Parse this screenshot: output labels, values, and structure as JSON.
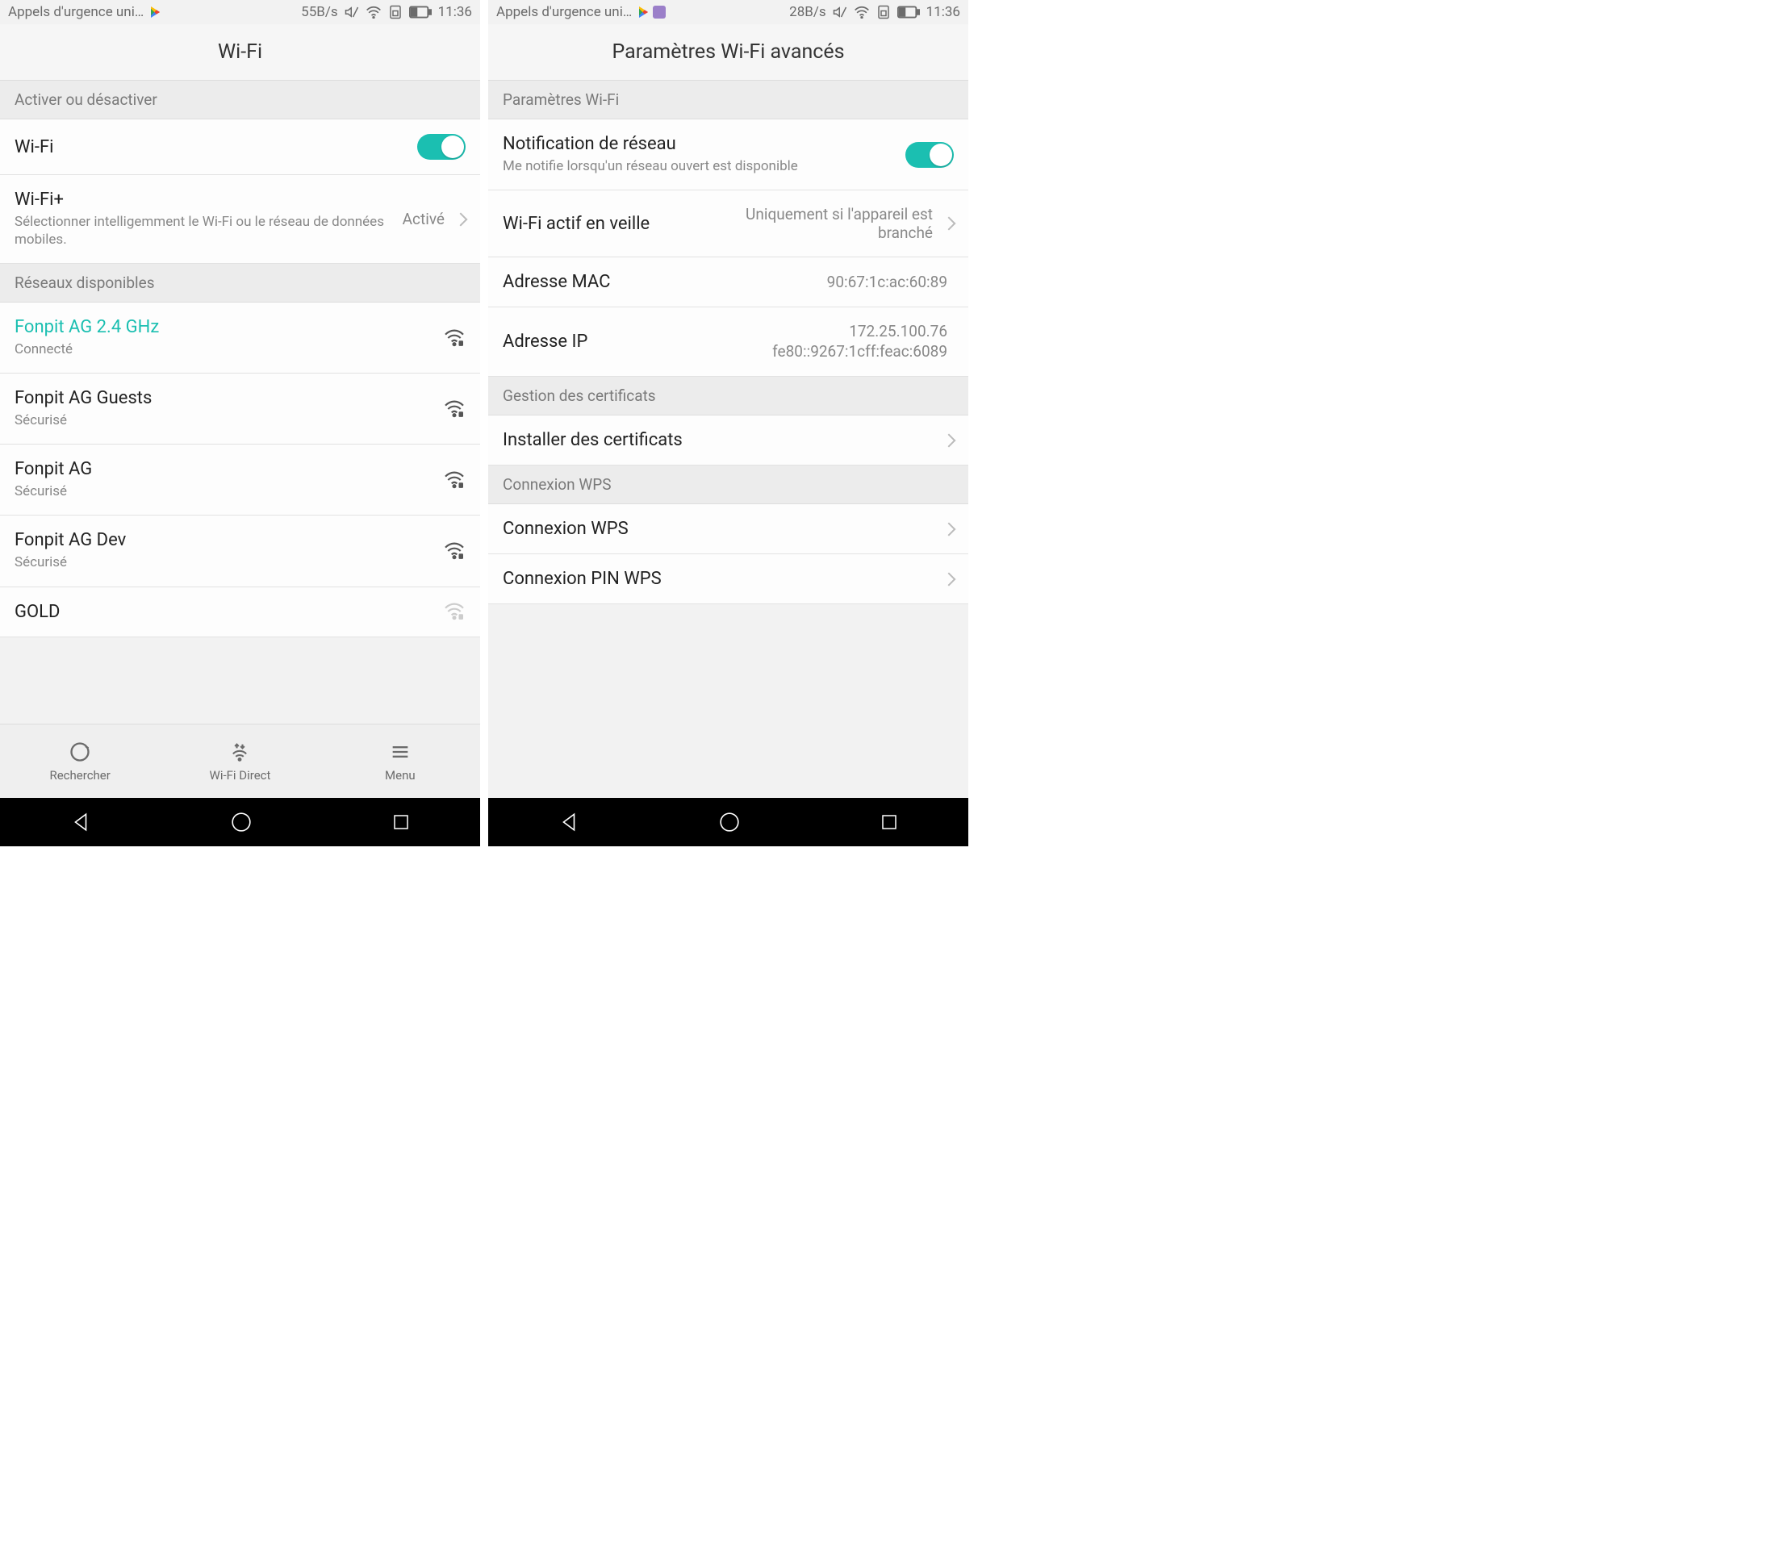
{
  "left": {
    "statusbar": {
      "carrier": "Appels d'urgence uni…",
      "dataRate": "55B/s",
      "time": "11:36"
    },
    "header": "Wi-Fi",
    "sections": {
      "toggleHeader": "Activer ou désactiver",
      "wifiLabel": "Wi-Fi",
      "wifiPlus": {
        "title": "Wi-Fi+",
        "subtitle": "Sélectionner intelligemment le Wi-Fi ou le réseau de données mobiles.",
        "value": "Activé"
      },
      "networksHeader": "Réseaux disponibles",
      "networks": [
        {
          "name": "Fonpit AG 2.4 GHz",
          "status": "Connecté",
          "active": true
        },
        {
          "name": "Fonpit AG Guests",
          "status": "Sécurisé",
          "active": false
        },
        {
          "name": "Fonpit AG",
          "status": "Sécurisé",
          "active": false
        },
        {
          "name": "Fonpit AG Dev",
          "status": "Sécurisé",
          "active": false
        },
        {
          "name": "GOLD",
          "status": "",
          "active": false
        }
      ]
    },
    "bottombar": {
      "search": "Rechercher",
      "wifiDirect": "Wi-Fi Direct",
      "menu": "Menu"
    }
  },
  "right": {
    "statusbar": {
      "carrier": "Appels d'urgence uni…",
      "dataRate": "28B/s",
      "time": "11:36"
    },
    "header": "Paramètres Wi-Fi avancés",
    "sections": {
      "wifiParamsHeader": "Paramètres Wi-Fi",
      "networkNotif": {
        "title": "Notification de réseau",
        "subtitle": "Me notifie lorsqu'un réseau ouvert est disponible"
      },
      "sleep": {
        "title": "Wi-Fi actif en veille",
        "value": "Uniquement si l'appareil est branché"
      },
      "mac": {
        "title": "Adresse MAC",
        "value": "90:67:1c:ac:60:89"
      },
      "ip": {
        "title": "Adresse IP",
        "value1": "172.25.100.76",
        "value2": "fe80::9267:1cff:feac:6089"
      },
      "certsHeader": "Gestion des certificats",
      "installCerts": "Installer des certificats",
      "wpsHeader": "Connexion WPS",
      "wpsConn": "Connexion WPS",
      "wpsPin": "Connexion PIN WPS"
    }
  }
}
